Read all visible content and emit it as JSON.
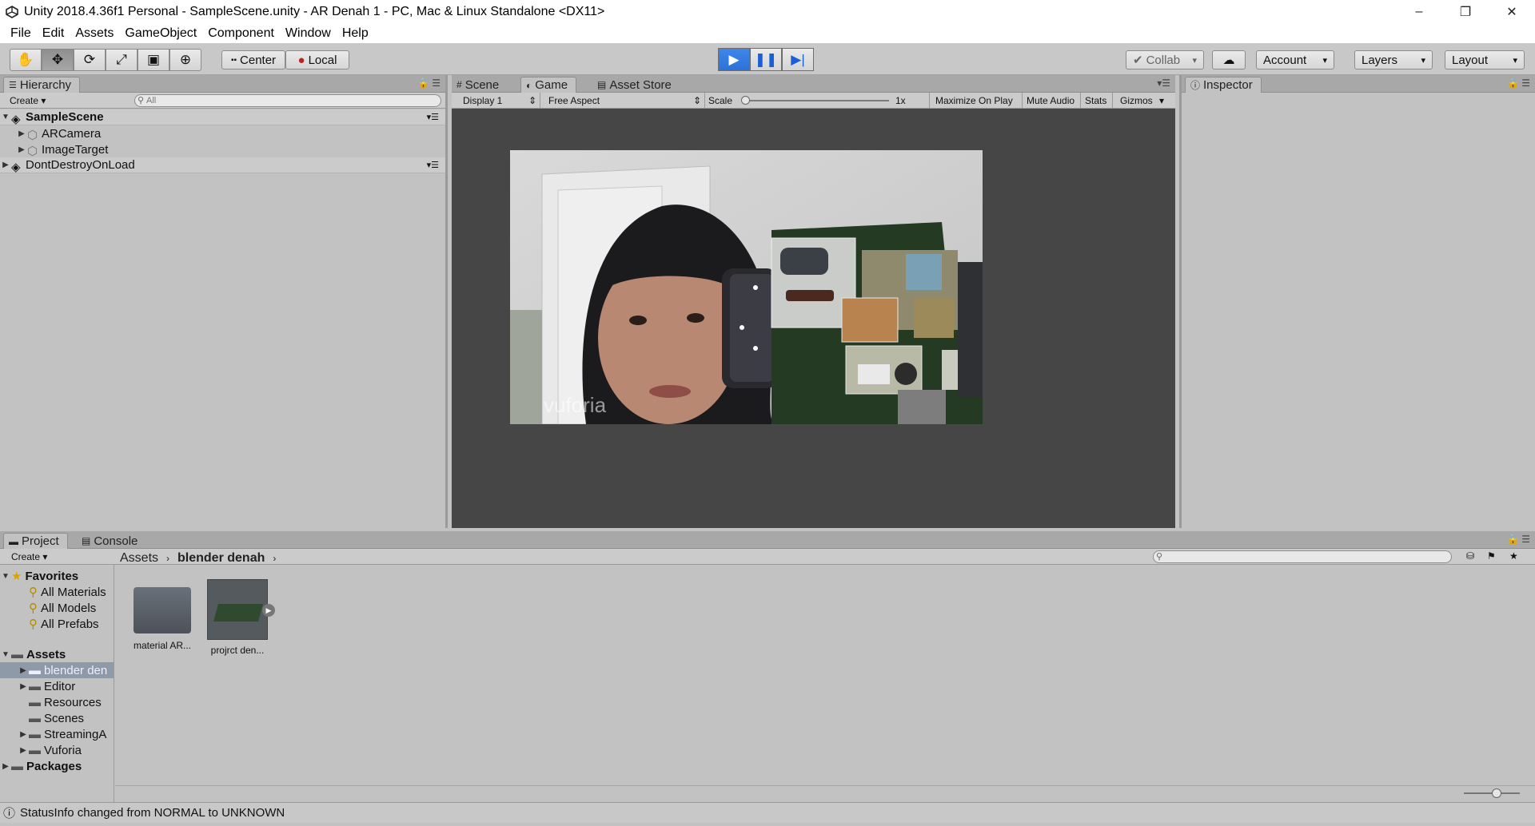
{
  "window": {
    "title": "Unity 2018.4.36f1 Personal - SampleScene.unity - AR Denah 1 - PC, Mac & Linux Standalone <DX11>",
    "controls": [
      "–",
      "❐",
      "✕"
    ]
  },
  "menu": [
    "File",
    "Edit",
    "Assets",
    "GameObject",
    "Component",
    "Window",
    "Help"
  ],
  "toolbar": {
    "center_label": "Center",
    "local_label": "Local",
    "collab_label": "Collab",
    "account_label": "Account",
    "layers_label": "Layers",
    "layout_label": "Layout"
  },
  "hierarchy": {
    "tab": "Hierarchy",
    "create": "Create",
    "search_placeholder": "All",
    "rows": [
      {
        "label": "SampleScene",
        "level": 0,
        "type": "scene"
      },
      {
        "label": "ARCamera",
        "level": 1,
        "type": "object"
      },
      {
        "label": "ImageTarget",
        "level": 1,
        "type": "object"
      },
      {
        "label": "DontDestroyOnLoad",
        "level": 0,
        "type": "scene"
      }
    ]
  },
  "center_tabs": [
    "Scene",
    "Game",
    "Asset Store"
  ],
  "game_bar": {
    "display": "Display 1",
    "aspect": "Free Aspect",
    "scale_label": "Scale",
    "scale_value": "1x",
    "maximize": "Maximize On Play",
    "mute": "Mute Audio",
    "stats": "Stats",
    "gizmos": "Gizmos"
  },
  "game_view": {
    "watermark": "vuforia"
  },
  "inspector": {
    "tab": "Inspector"
  },
  "project": {
    "tabs": [
      "Project",
      "Console"
    ],
    "create": "Create",
    "favorites_label": "Favorites",
    "favorites": [
      "All Materials",
      "All Models",
      "All Prefabs"
    ],
    "assets_label": "Assets",
    "assets_tree": [
      "blender den",
      "Editor",
      "Resources",
      "Scenes",
      "StreamingA",
      "Vuforia"
    ],
    "packages_label": "Packages",
    "breadcrumb": [
      "Assets",
      "blender denah"
    ],
    "items": [
      "material AR...",
      "projrct den..."
    ]
  },
  "status": {
    "text": "StatusInfo changed from NORMAL to UNKNOWN"
  },
  "colors": {
    "play_active": "#2b73d9",
    "selection": "#8e9aa8",
    "game_bg": "#464646"
  }
}
